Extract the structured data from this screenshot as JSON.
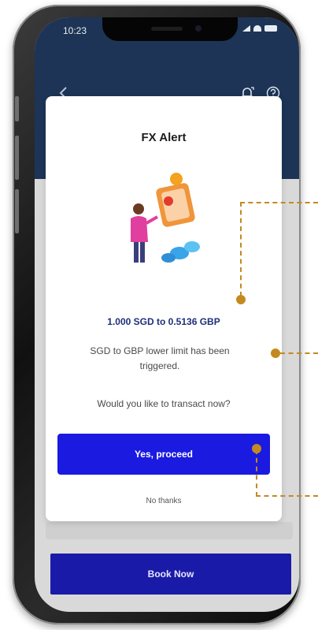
{
  "status_bar": {
    "time": "10:23"
  },
  "icons": {
    "back": "back-arrow-icon",
    "bell": "bell-alert-icon",
    "help": "help-circle-icon"
  },
  "modal": {
    "title": "FX Alert",
    "rate_line": "1.000 SGD to 0.5136 GBP",
    "message": "SGD to GBP lower limit has been triggered.",
    "question": "Would you like to transact now?",
    "proceed_label": "Yes, proceed",
    "dismiss_label": "No thanks"
  },
  "footer": {
    "book_label": "Book Now"
  },
  "colors": {
    "header_bg": "#1d3456",
    "primary_button": "#1a1ae0",
    "book_button": "#1a1aa8",
    "rate_text": "#1d2f7a",
    "callout": "#c48a1f"
  }
}
